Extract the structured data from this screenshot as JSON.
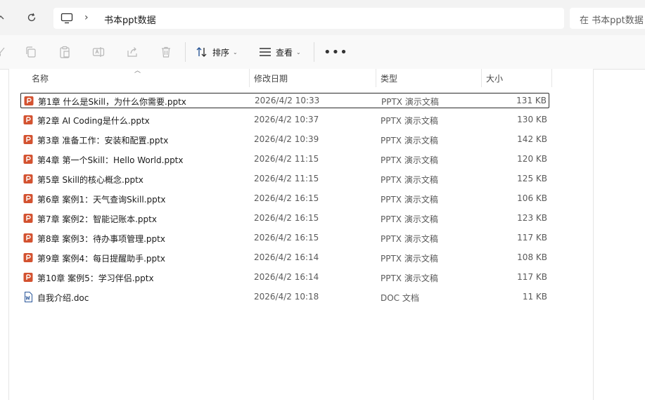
{
  "address": {
    "path_label": "书本ppt数据",
    "search_placeholder": "在 书本ppt数据"
  },
  "toolbar": {
    "sort_label": "排序",
    "view_label": "查看"
  },
  "columns": {
    "name": "名称",
    "date": "修改日期",
    "type": "类型",
    "size": "大小"
  },
  "files": [
    {
      "name": "第1章 什么是Skill，为什么你需要.pptx",
      "date": "2026/4/2 10:33",
      "type": "PPTX 演示文稿",
      "size": "131 KB",
      "icon": "pptx-file-icon",
      "selected": true
    },
    {
      "name": "第2章 AI Coding是什么.pptx",
      "date": "2026/4/2 10:37",
      "type": "PPTX 演示文稿",
      "size": "130 KB",
      "icon": "pptx-file-icon"
    },
    {
      "name": "第3章 准备工作：安装和配置.pptx",
      "date": "2026/4/2 10:39",
      "type": "PPTX 演示文稿",
      "size": "142 KB",
      "icon": "pptx-file-icon"
    },
    {
      "name": "第4章 第一个Skill：Hello World.pptx",
      "date": "2026/4/2 11:15",
      "type": "PPTX 演示文稿",
      "size": "120 KB",
      "icon": "pptx-file-icon"
    },
    {
      "name": "第5章 Skill的核心概念.pptx",
      "date": "2026/4/2 11:15",
      "type": "PPTX 演示文稿",
      "size": "125 KB",
      "icon": "pptx-file-icon"
    },
    {
      "name": "第6章 案例1：天气查询Skill.pptx",
      "date": "2026/4/2 16:15",
      "type": "PPTX 演示文稿",
      "size": "106 KB",
      "icon": "pptx-file-icon"
    },
    {
      "name": "第7章 案例2：智能记账本.pptx",
      "date": "2026/4/2 16:15",
      "type": "PPTX 演示文稿",
      "size": "123 KB",
      "icon": "pptx-file-icon"
    },
    {
      "name": "第8章 案例3：待办事项管理.pptx",
      "date": "2026/4/2 16:15",
      "type": "PPTX 演示文稿",
      "size": "117 KB",
      "icon": "pptx-file-icon"
    },
    {
      "name": "第9章 案例4：每日提醒助手.pptx",
      "date": "2026/4/2 16:14",
      "type": "PPTX 演示文稿",
      "size": "108 KB",
      "icon": "pptx-file-icon"
    },
    {
      "name": "第10章 案例5：学习伴侣.pptx",
      "date": "2026/4/2 16:14",
      "type": "PPTX 演示文稿",
      "size": "117 KB",
      "icon": "pptx-file-icon"
    },
    {
      "name": "自我介绍.doc",
      "date": "2026/4/2 10:18",
      "type": "DOC 文档",
      "size": "11 KB",
      "icon": "doc-file-icon"
    }
  ],
  "colors": {
    "pptx_icon": "#d35230",
    "doc_icon": "#2b579a",
    "selection_border": "#2b2b2b"
  }
}
